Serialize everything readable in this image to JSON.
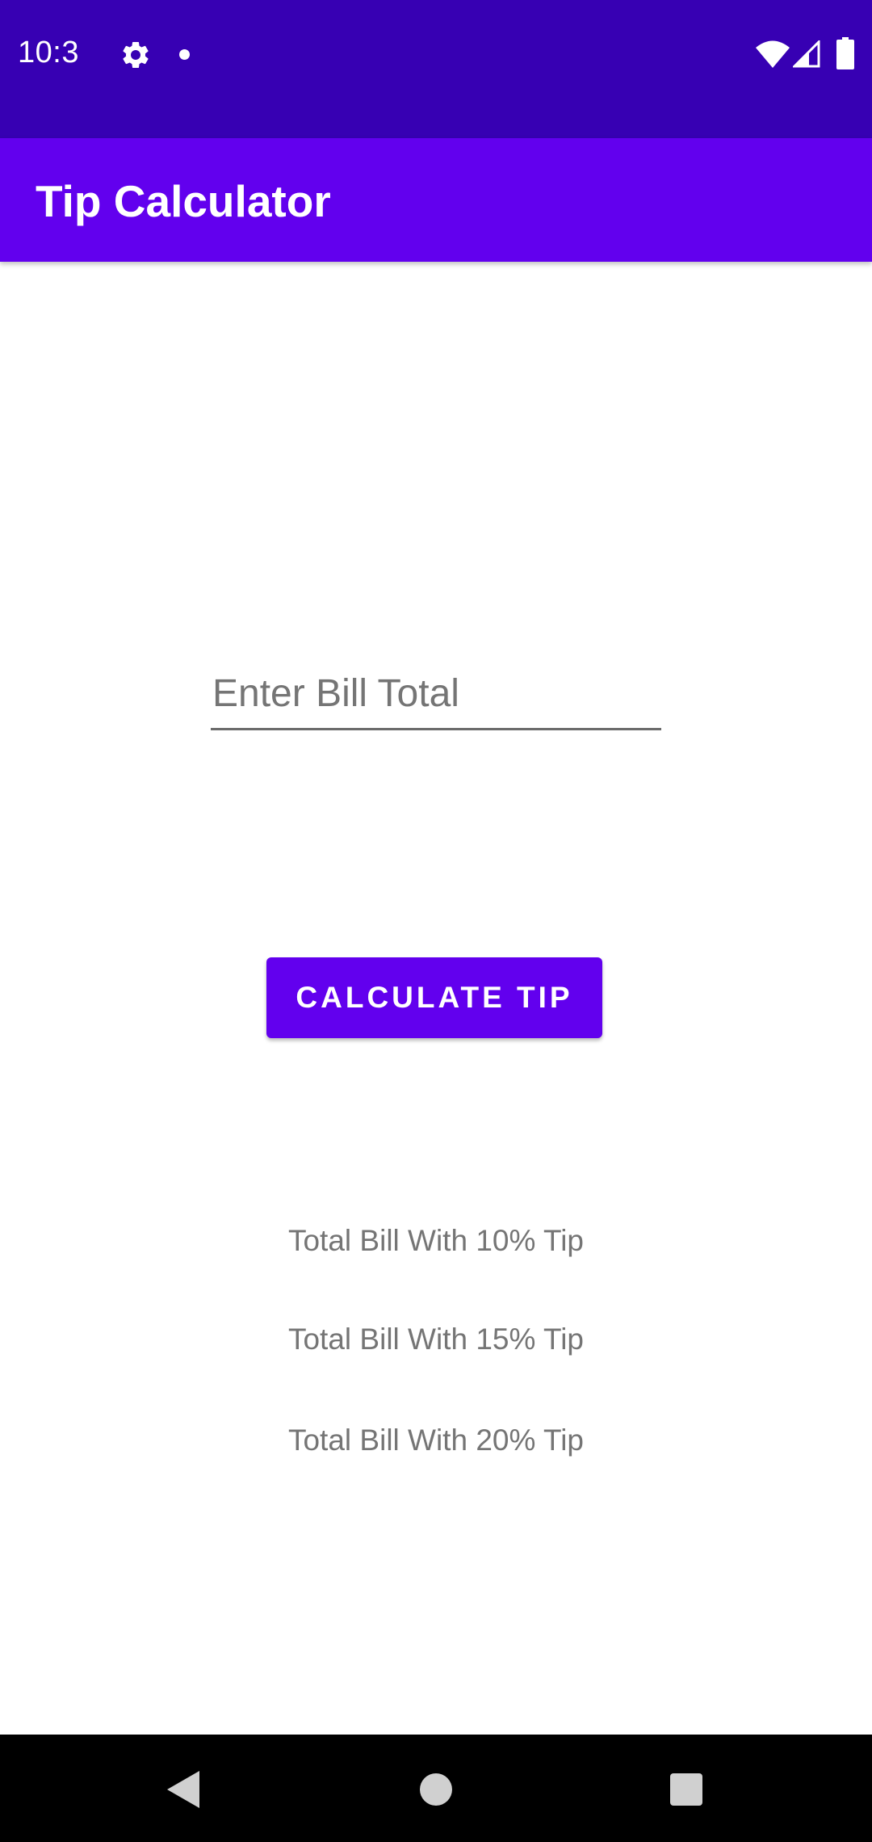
{
  "status_bar": {
    "time": "10:3",
    "icons": [
      "gear-icon",
      "notification-dot-icon",
      "wifi-icon",
      "cell-signal-icon",
      "battery-icon"
    ]
  },
  "app_bar": {
    "title": "Tip Calculator"
  },
  "bill_input": {
    "value": "",
    "placeholder": "Enter Bill Total"
  },
  "calculate_button": {
    "label": "CALCULATE TIP"
  },
  "results": {
    "tip_10": "Total Bill With 10% Tip",
    "tip_15": "Total Bill With 15% Tip",
    "tip_20": "Total Bill With 20% Tip"
  },
  "nav_bar": {
    "icons": [
      "back-icon",
      "home-icon",
      "recents-icon"
    ]
  },
  "colors": {
    "status_bar": "#3700b3",
    "primary": "#6200ee",
    "result_text": "#757575",
    "nav_bar": "#000000"
  }
}
